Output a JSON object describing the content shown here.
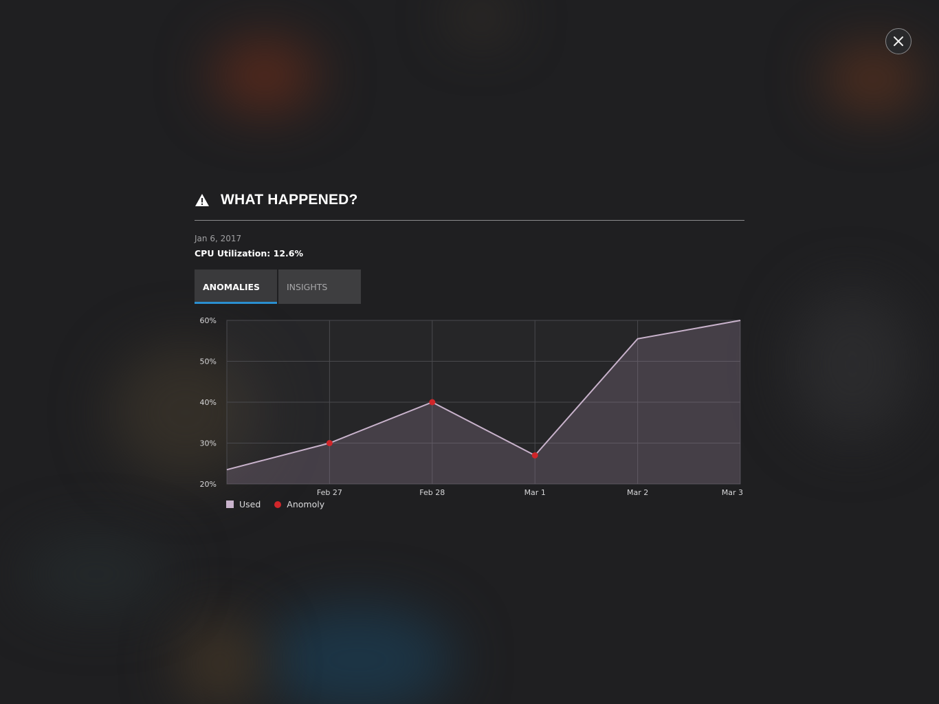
{
  "modal": {
    "title": "WHAT HAPPENED?",
    "icon": "warning-icon",
    "date": "Jan 6, 2017",
    "metric": "CPU Utilization: 12.6%"
  },
  "tabs": [
    {
      "label": "ANOMALIES",
      "active": true
    },
    {
      "label": "INSIGHTS",
      "active": false
    }
  ],
  "colors": {
    "accent": "#2a8fd0",
    "line": "#c9b3cc",
    "anomaly": "#d0262a"
  },
  "chart_data": {
    "type": "area",
    "x": [
      "",
      "Feb 27",
      "Feb 28",
      "Mar 1",
      "Mar 2",
      "Mar 3"
    ],
    "series": [
      {
        "name": "Used",
        "values": [
          23.5,
          30,
          40,
          27,
          55.5,
          60
        ]
      }
    ],
    "anomalies": [
      {
        "index": 1,
        "value": 30
      },
      {
        "index": 2,
        "value": 40
      },
      {
        "index": 3,
        "value": 27
      }
    ],
    "yticks": [
      "20%",
      "30%",
      "40%",
      "50%",
      "60%"
    ],
    "ylim": [
      20,
      60
    ],
    "grid": true,
    "legend": [
      {
        "label": "Used",
        "kind": "swatch"
      },
      {
        "label": "Anomoly",
        "kind": "dot"
      }
    ],
    "legend_position": "bottom-left"
  }
}
